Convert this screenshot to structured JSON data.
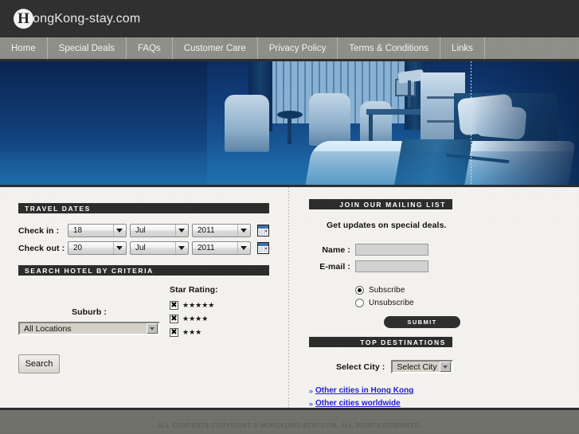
{
  "site": {
    "logo_initial": "H",
    "logo_text": "ongKong-stay.com"
  },
  "nav": {
    "items": [
      {
        "label": "Home"
      },
      {
        "label": "Special Deals"
      },
      {
        "label": "FAQs"
      },
      {
        "label": "Customer Care"
      },
      {
        "label": "Privacy Policy"
      },
      {
        "label": "Terms & Conditions"
      },
      {
        "label": "Links"
      }
    ]
  },
  "hero": {
    "alt": "hotel-room-banner"
  },
  "travel_dates": {
    "heading": "TRAVEL DATES",
    "check_in_label": "Check in :",
    "check_out_label": "Check out :",
    "check_in": {
      "day": "18",
      "month": "Jul",
      "year": "2011"
    },
    "check_out": {
      "day": "20",
      "month": "Jul",
      "year": "2011"
    },
    "calendar_icon": "calendar-icon"
  },
  "criteria": {
    "heading": "SEARCH HOTEL BY CRITERIA",
    "suburb_label": "Suburb :",
    "suburb_value": "All Locations",
    "star_rating_label": "Star Rating:",
    "ratings": [
      {
        "stars": "★★★★★",
        "checked": "✖"
      },
      {
        "stars": "★★★★",
        "checked": "✖"
      },
      {
        "stars": "★★★",
        "checked": "✖"
      }
    ],
    "search_label": "Search"
  },
  "mailing": {
    "heading": "JOIN OUR MAILING LIST",
    "intro": "Get updates on special deals.",
    "name_label": "Name :",
    "name_value": "",
    "email_label": "E-mail :",
    "email_value": "",
    "subscribe_label": "Subscribe",
    "unsubscribe_label": "Unsubscribe",
    "selected": "Subscribe",
    "submit_label": "SUBMIT"
  },
  "top_destinations": {
    "heading": "TOP DESTINATIONS",
    "select_city_label": "Select City :",
    "select_city_value": "Select City",
    "links": [
      {
        "bullet": "»",
        "label": "Other cities in Hong Kong"
      },
      {
        "bullet": "»",
        "label": "Other cities worldwide"
      }
    ]
  },
  "footer": {
    "copyright": "ALL CONTENTS COPYRIGHT © HONGKONG-STAY.COM. ALL RIGHTS RESERVED."
  },
  "colors": {
    "header_dark": "#2e2e2e",
    "nav_grey": "#8c8c86",
    "content_bg": "#f4f2ee",
    "link_blue": "#2020cc",
    "page_bg": "#6f6f6a"
  }
}
